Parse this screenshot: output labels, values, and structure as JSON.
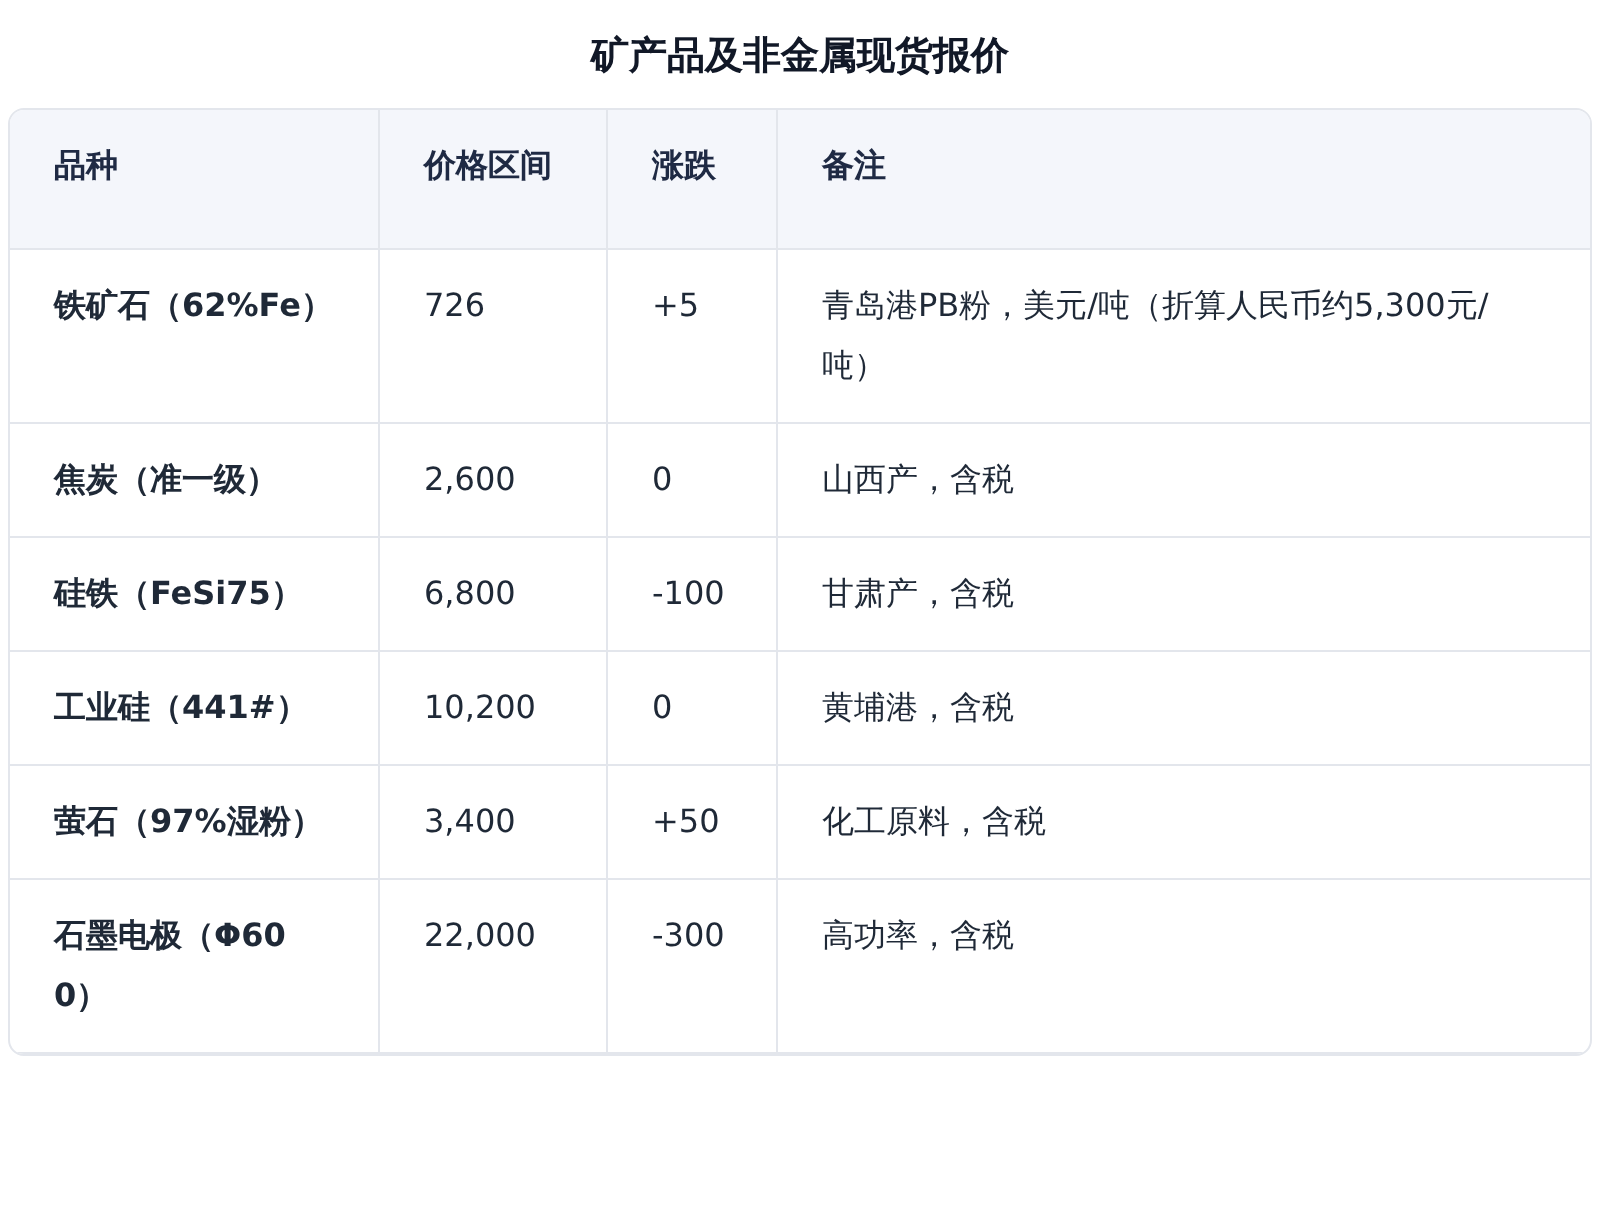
{
  "title": "矿产品及非金属现货报价",
  "table": {
    "columns": [
      "品种",
      "价格区间",
      "涨跌",
      "备注"
    ],
    "rows": [
      {
        "cells": [
          "铁矿石（62%Fe）",
          "726",
          "+5",
          "青岛港PB粉，美元/吨（折算人民币约5,300元/吨）"
        ]
      },
      {
        "cells": [
          "焦炭（准一级）",
          "2,600",
          "0",
          "山西产，含税"
        ]
      },
      {
        "cells": [
          "硅铁（FeSi75）",
          "6,800",
          "-100",
          "甘肃产，含税"
        ]
      },
      {
        "cells": [
          "工业硅（441#）",
          "10,200",
          "0",
          "黄埔港，含税"
        ]
      },
      {
        "cells": [
          "萤石（97%湿粉）",
          "3,400",
          "+50",
          "化工原料，含税"
        ]
      },
      {
        "cells": [
          "石墨电极（Φ600）",
          "22,000",
          "-300",
          "高功率，含税"
        ]
      }
    ]
  }
}
